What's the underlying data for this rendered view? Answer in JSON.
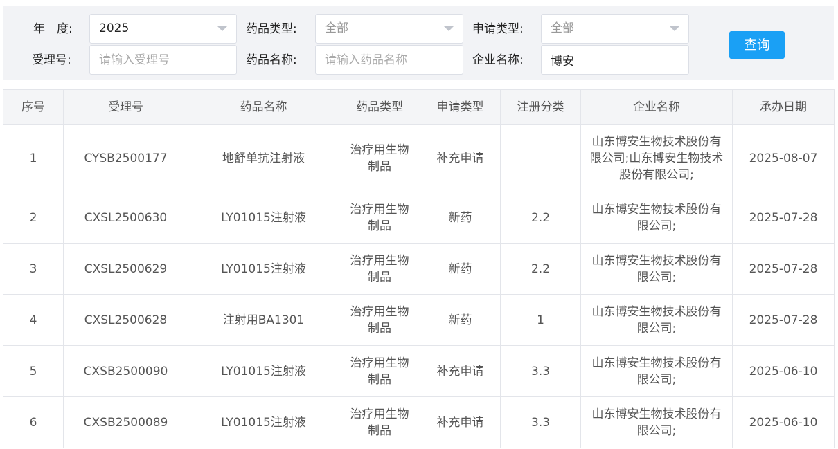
{
  "filters": {
    "year": {
      "label": "年　度:",
      "value": "2025"
    },
    "drug_type": {
      "label": "药品类型:",
      "value": "全部"
    },
    "apply_type": {
      "label": "申请类型:",
      "value": "全部"
    },
    "accept_no": {
      "label": "受理号:",
      "placeholder": "请输入受理号"
    },
    "drug_name": {
      "label": "药品名称:",
      "placeholder": "请输入药品名称"
    },
    "company": {
      "label": "企业名称:",
      "value": "博安"
    },
    "query_label": "查询"
  },
  "table": {
    "headers": [
      "序号",
      "受理号",
      "药品名称",
      "药品类型",
      "申请类型",
      "注册分类",
      "企业名称",
      "承办日期"
    ],
    "rows": [
      {
        "no": "1",
        "accept_no": "CYSB2500177",
        "drug_name": "地舒单抗注射液",
        "drug_type": "治疗用生物制品",
        "apply_type": "补充申请",
        "reg_class": "",
        "company": "山东博安生物技术股份有限公司;山东博安生物技术股份有限公司;",
        "date": "2025-08-07"
      },
      {
        "no": "2",
        "accept_no": "CXSL2500630",
        "drug_name": "LY01015注射液",
        "drug_type": "治疗用生物制品",
        "apply_type": "新药",
        "reg_class": "2.2",
        "company": "山东博安生物技术股份有限公司;",
        "date": "2025-07-28"
      },
      {
        "no": "3",
        "accept_no": "CXSL2500629",
        "drug_name": "LY01015注射液",
        "drug_type": "治疗用生物制品",
        "apply_type": "新药",
        "reg_class": "2.2",
        "company": "山东博安生物技术股份有限公司;",
        "date": "2025-07-28"
      },
      {
        "no": "4",
        "accept_no": "CXSL2500628",
        "drug_name": "注射用BA1301",
        "drug_type": "治疗用生物制品",
        "apply_type": "新药",
        "reg_class": "1",
        "company": "山东博安生物技术股份有限公司;",
        "date": "2025-07-28"
      },
      {
        "no": "5",
        "accept_no": "CXSB2500090",
        "drug_name": "LY01015注射液",
        "drug_type": "治疗用生物制品",
        "apply_type": "补充申请",
        "reg_class": "3.3",
        "company": "山东博安生物技术股份有限公司;",
        "date": "2025-06-10"
      },
      {
        "no": "6",
        "accept_no": "CXSB2500089",
        "drug_name": "LY01015注射液",
        "drug_type": "治疗用生物制品",
        "apply_type": "补充申请",
        "reg_class": "3.3",
        "company": "山东博安生物技术股份有限公司;",
        "date": "2025-06-10"
      }
    ]
  }
}
